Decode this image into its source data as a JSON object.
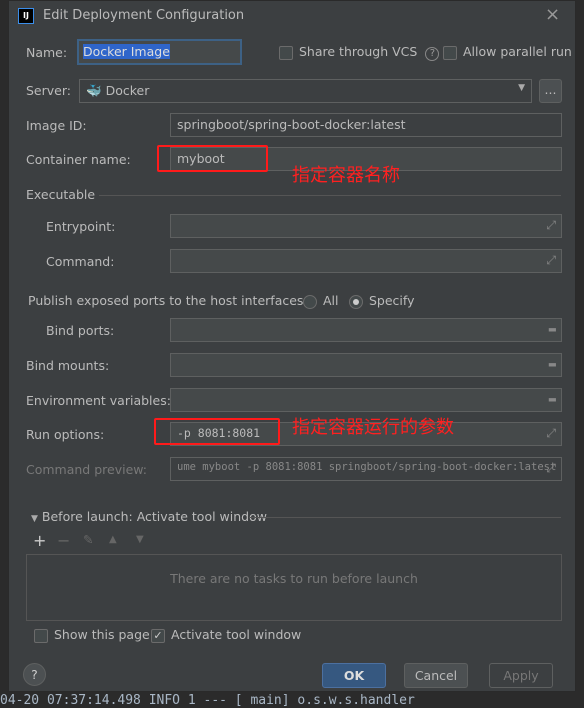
{
  "title": "Edit Deployment Configuration",
  "name": {
    "label": "Name:",
    "value": "Docker Image"
  },
  "share_vcs": {
    "label": "Share through VCS",
    "checked": false
  },
  "allow_parallel": {
    "label": "Allow parallel run",
    "checked": false
  },
  "server": {
    "label": "Server:",
    "value": "Docker",
    "more": "..."
  },
  "image_id": {
    "label": "Image ID:",
    "value": "springboot/spring-boot-docker:latest"
  },
  "container_name": {
    "label": "Container name:",
    "value": "myboot"
  },
  "executable": {
    "label": "Executable",
    "entrypoint": "Entrypoint:",
    "command": "Command:"
  },
  "publish": {
    "label": "Publish exposed ports to the host interfaces:",
    "all": "All",
    "specify": "Specify",
    "selected": "Specify"
  },
  "bind_ports": {
    "label": "Bind ports:"
  },
  "bind_mounts": {
    "label": "Bind mounts:"
  },
  "env_vars": {
    "label": "Environment variables:"
  },
  "run_options": {
    "label": "Run options:",
    "value": "-p 8081:8081"
  },
  "command_preview": {
    "label": "Command preview:",
    "value": "ume myboot -p 8081:8081 springboot/spring-boot-docker:latest"
  },
  "before_launch": {
    "label": "Before launch: Activate tool window",
    "empty": "There are no tasks to run before launch"
  },
  "show_page": {
    "label": "Show this page",
    "checked": false
  },
  "activate_tool": {
    "label": "Activate tool window",
    "checked": true
  },
  "buttons": {
    "ok": "OK",
    "cancel": "Cancel",
    "apply": "Apply",
    "help": "?"
  },
  "annotations": {
    "container": "指定容器名称",
    "run": "指定容器运行的参数"
  },
  "log_line": "04-20 07:37:14.498  INFO 1 ---  [           main] o.s.w.s.handler",
  "colors": {
    "accent": "#365880",
    "annotation": "#ff1a1a"
  }
}
